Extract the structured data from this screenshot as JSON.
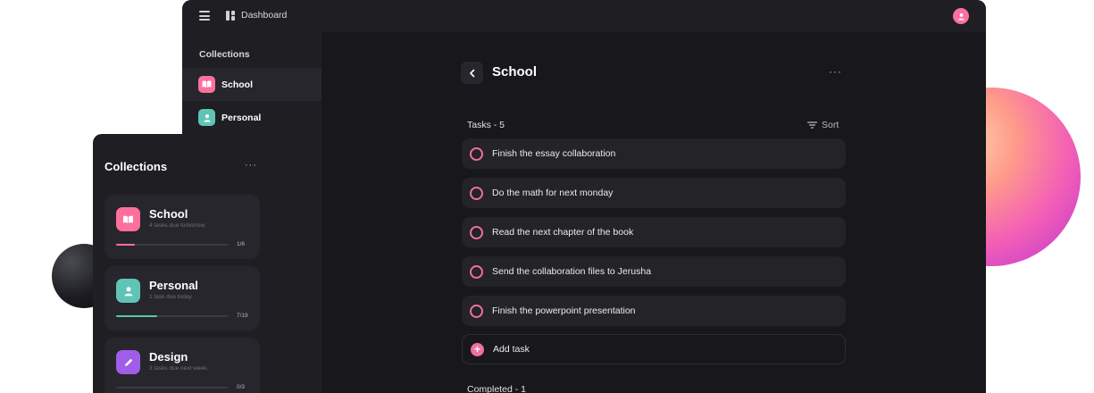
{
  "colors": {
    "accent_pink": "#f0709e",
    "accent_teal": "#5fc4b6",
    "accent_purple": "#a05ee8",
    "window_bg": "#1e1e23",
    "main_bg": "#18181c"
  },
  "topbar": {
    "menu_icon": "menu-icon",
    "dashboard_icon": "dashboard-icon",
    "dashboard_label": "Dashboard",
    "avatar_icon": "user-icon"
  },
  "sidebar": {
    "title": "Collections",
    "items": [
      {
        "label": "School",
        "icon": "book-icon",
        "color": "#ff6f9c"
      },
      {
        "label": "Personal",
        "icon": "user-icon",
        "color": "#5fc4b6"
      }
    ]
  },
  "main": {
    "title": "School",
    "more": "···",
    "tasks_heading": "Tasks - 5",
    "sort_label": "Sort",
    "tasks": [
      {
        "label": "Finish the essay collaboration"
      },
      {
        "label": "Do the math for next monday"
      },
      {
        "label": "Read the next chapter of the book"
      },
      {
        "label": "Send the collaboration files to Jerusha"
      },
      {
        "label": "Finish the powerpoint presentation"
      }
    ],
    "add_task_label": "Add task",
    "completed_heading": "Completed - 1"
  },
  "panel": {
    "title": "Collections",
    "more": "···",
    "cards": [
      {
        "name": "School",
        "subtitle": "4 tasks due tomorrow.",
        "count": "1/6",
        "progress": 0.167,
        "color": "#ff6f9c",
        "icon": "book-icon"
      },
      {
        "name": "Personal",
        "subtitle": "1 task due today.",
        "count": "7/19",
        "progress": 0.368,
        "color": "#5fc4b6",
        "icon": "user-icon"
      },
      {
        "name": "Design",
        "subtitle": "3 tasks due next week.",
        "count": "0/3",
        "progress": 0,
        "color": "#a05ee8",
        "icon": "pencil-icon"
      }
    ]
  }
}
